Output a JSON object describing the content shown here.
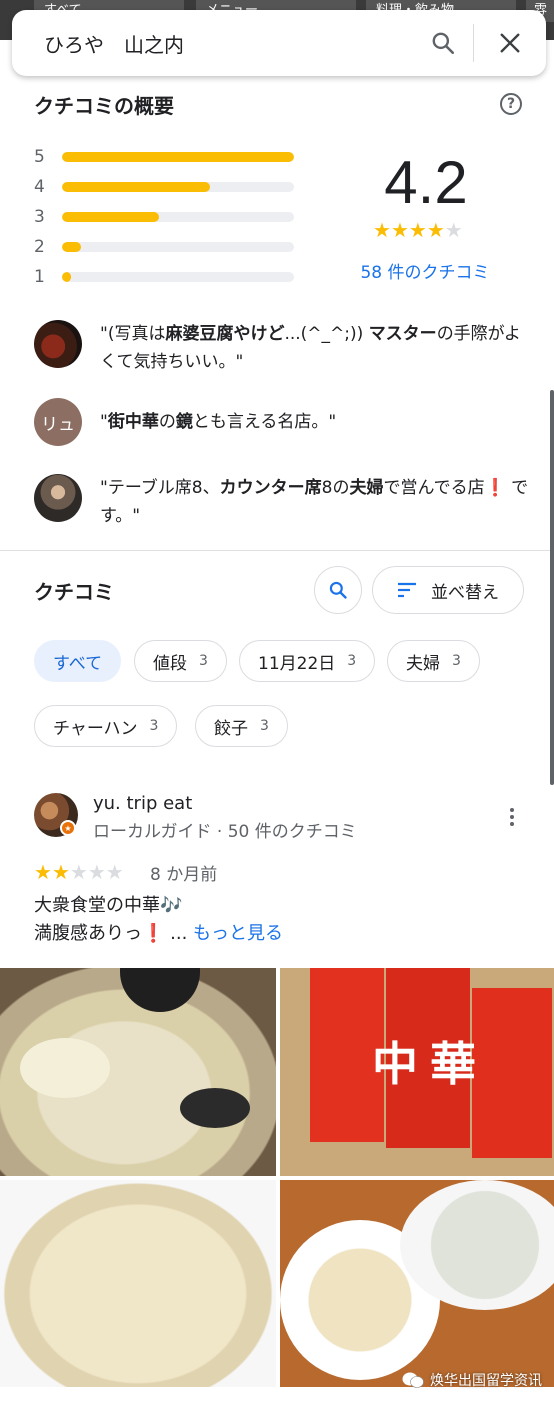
{
  "top_strip": {
    "chips": [
      "すべて",
      "メニュー",
      "料理・飲み物",
      "雰"
    ]
  },
  "search": {
    "query": "ひろや　山之内"
  },
  "summary": {
    "title": "クチコミの概要",
    "rating": "4.2",
    "rating_value": 4.2,
    "review_count": "58 件のクチコミ",
    "bars": [
      {
        "label": "5",
        "fraction": 1.0
      },
      {
        "label": "4",
        "fraction": 0.64
      },
      {
        "label": "3",
        "fraction": 0.42
      },
      {
        "label": "2",
        "fraction": 0.08
      },
      {
        "label": "1",
        "fraction": 0.04
      }
    ]
  },
  "snippets": [
    {
      "avatar_initials": "",
      "pre": "\"(写真は",
      "bold1": "麻婆豆腐やけど",
      "mid1": "...(^_^;)) ",
      "bold2": "マスター",
      "mid2": "の手際がよくて気持ちいい。\"",
      "bold3": "",
      "post": ""
    },
    {
      "avatar_initials": "リュ",
      "pre": "\"",
      "bold1": "街中華",
      "mid1": "の",
      "bold2": "鏡",
      "mid2": "とも言える名店。\"",
      "bold3": "",
      "post": ""
    },
    {
      "avatar_initials": "",
      "pre": "\"テーブル席8、",
      "bold1": "カウンター席",
      "mid1": "8の",
      "bold2": "夫婦",
      "mid2": "で営んでる店",
      "bold3": "❗",
      "post": " です。\""
    }
  ],
  "reviews_section": {
    "title": "クチコミ",
    "sort_label": "並べ替え"
  },
  "filters": [
    {
      "label": "すべて",
      "count": ""
    },
    {
      "label": "値段",
      "count": "3"
    },
    {
      "label": "11月22日",
      "count": "3"
    },
    {
      "label": "夫婦",
      "count": "3"
    },
    {
      "label": "チャーハン",
      "count": "3"
    },
    {
      "label": "餃子",
      "count": "3"
    }
  ],
  "review": {
    "author": "yu. trip eat",
    "subtitle": "ローカルガイド · 50 件のクチコミ",
    "stars": 2,
    "time": "8 か月前",
    "line1": "大衆食堂の中華🎶",
    "line2_pre": "満腹感ありっ",
    "line2_excl": "❗",
    "line2_post": " ... ",
    "more": "もっと見る"
  },
  "photos": [
    "soup-photo",
    "noren-photo",
    "fried-rice-photo",
    "table-photo"
  ],
  "watermark": {
    "text": "焕华出国留学资讯"
  },
  "colors": {
    "accent": "#1a73e8",
    "star": "#fbbc04",
    "chip_active_bg": "#e8f0fe"
  }
}
